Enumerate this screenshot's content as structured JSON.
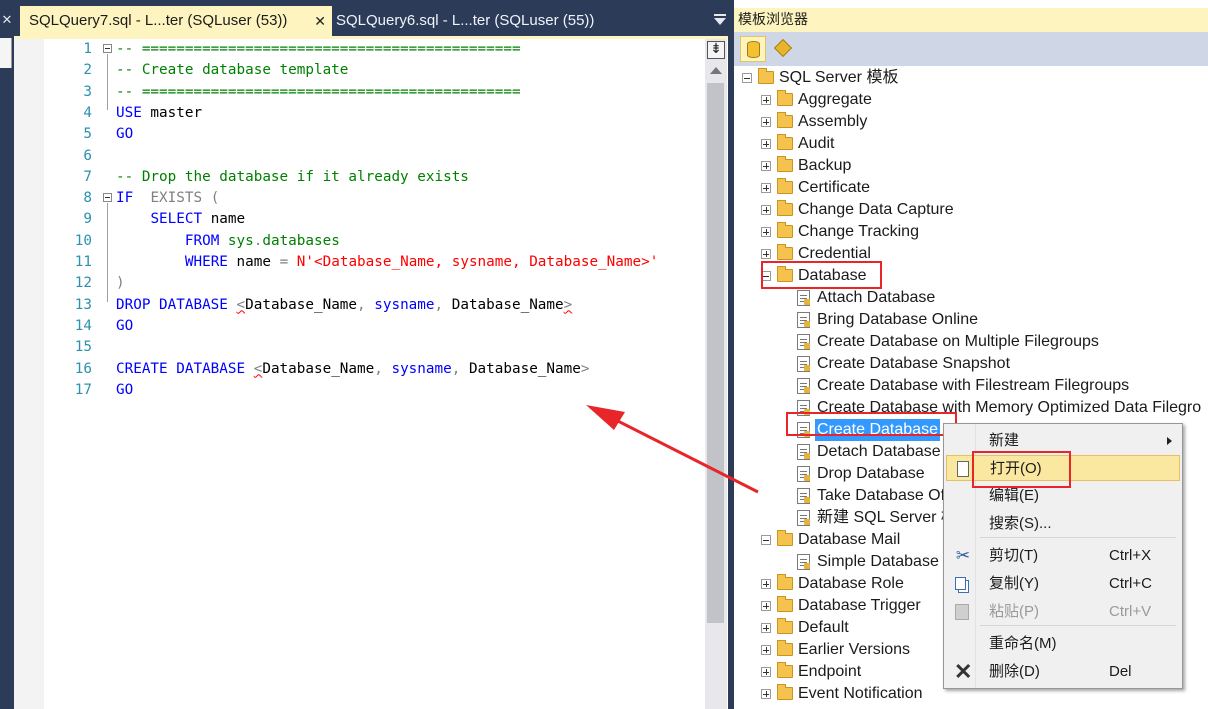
{
  "tabs": {
    "active_label": "SQLQuery7.sql - L...ter (SQLuser (53))",
    "active_close": "✕",
    "inactive_label": "SQLQuery6.sql - L...ter (SQLuser (55))"
  },
  "left_strip": {
    "close": "✕"
  },
  "editor": {
    "lines": [
      {
        "n": "1",
        "parts": [
          {
            "c": "cmt",
            "t": "-- ============================================"
          }
        ]
      },
      {
        "n": "2",
        "parts": [
          {
            "c": "cmt",
            "t": "-- Create database template"
          }
        ]
      },
      {
        "n": "3",
        "parts": [
          {
            "c": "cmt",
            "t": "-- ============================================"
          }
        ]
      },
      {
        "n": "4",
        "parts": [
          {
            "c": "kw",
            "t": "USE"
          },
          {
            "c": "txt",
            "t": " master"
          }
        ]
      },
      {
        "n": "5",
        "parts": [
          {
            "c": "kw",
            "t": "GO"
          }
        ]
      },
      {
        "n": "6",
        "parts": []
      },
      {
        "n": "7",
        "parts": [
          {
            "c": "cmt",
            "t": "-- Drop the database if it already exists"
          }
        ]
      },
      {
        "n": "8",
        "parts": [
          {
            "c": "kw",
            "t": "IF"
          },
          {
            "c": "txt",
            "t": "  "
          },
          {
            "c": "gray",
            "t": "EXISTS ("
          }
        ]
      },
      {
        "n": "9",
        "parts": [
          {
            "c": "txt",
            "t": "    "
          },
          {
            "c": "kw",
            "t": "SELECT"
          },
          {
            "c": "txt",
            "t": " name"
          }
        ]
      },
      {
        "n": "10",
        "parts": [
          {
            "c": "txt",
            "t": "        "
          },
          {
            "c": "kw",
            "t": "FROM"
          },
          {
            "c": "txt",
            "t": " "
          },
          {
            "c": "fn",
            "t": "sys"
          },
          {
            "c": "gray",
            "t": "."
          },
          {
            "c": "fn",
            "t": "databases"
          }
        ]
      },
      {
        "n": "11",
        "parts": [
          {
            "c": "txt",
            "t": "        "
          },
          {
            "c": "kw",
            "t": "WHERE"
          },
          {
            "c": "txt",
            "t": " name "
          },
          {
            "c": "gray",
            "t": "="
          },
          {
            "c": "txt",
            "t": " "
          },
          {
            "c": "str",
            "t": "N'<Database_Name, sysname, Database_Name>'"
          }
        ]
      },
      {
        "n": "12",
        "parts": [
          {
            "c": "gray",
            "t": ")"
          }
        ]
      },
      {
        "n": "13",
        "parts": [
          {
            "c": "kw",
            "t": "DROP DATABASE"
          },
          {
            "c": "txt",
            "t": " "
          },
          {
            "c": "gray squig",
            "t": "<"
          },
          {
            "c": "txt",
            "t": "Database_Name"
          },
          {
            "c": "gray",
            "t": ","
          },
          {
            "c": "txt",
            "t": " "
          },
          {
            "c": "kw",
            "t": "sysname"
          },
          {
            "c": "gray",
            "t": ","
          },
          {
            "c": "txt",
            "t": " Database_Name"
          },
          {
            "c": "gray squig",
            "t": ">"
          }
        ]
      },
      {
        "n": "14",
        "parts": [
          {
            "c": "kw",
            "t": "GO"
          }
        ]
      },
      {
        "n": "15",
        "parts": []
      },
      {
        "n": "16",
        "parts": [
          {
            "c": "kw",
            "t": "CREATE DATABASE"
          },
          {
            "c": "txt",
            "t": " "
          },
          {
            "c": "gray squig",
            "t": "<"
          },
          {
            "c": "txt",
            "t": "Database_Name"
          },
          {
            "c": "gray",
            "t": ","
          },
          {
            "c": "txt",
            "t": " "
          },
          {
            "c": "kw",
            "t": "sysname"
          },
          {
            "c": "gray",
            "t": ","
          },
          {
            "c": "txt",
            "t": " Database_Name"
          },
          {
            "c": "gray",
            "t": ">"
          }
        ]
      },
      {
        "n": "17",
        "parts": [
          {
            "c": "kw",
            "t": "GO"
          }
        ]
      }
    ]
  },
  "template_browser": {
    "title": "模板浏览器",
    "root": "SQL Server 模板",
    "folders_top": [
      "Aggregate",
      "Assembly",
      "Audit",
      "Backup",
      "Certificate",
      "Change Data Capture",
      "Change Tracking",
      "Credential"
    ],
    "database_folder": "Database",
    "database_items": [
      "Attach Database",
      "Bring Database Online",
      "Create Database on Multiple Filegroups",
      "Create Database Snapshot",
      "Create Database with Filestream Filegroups",
      "Create Database with Memory Optimized Data Filegro",
      "Create Database",
      "Detach Database",
      "Drop Database",
      "Take Database Of",
      "新建 SQL Server 模"
    ],
    "selected_item": "Create Database",
    "database_mail_folder": "Database Mail",
    "database_mail_items": [
      "Simple Database"
    ],
    "folders_bottom": [
      "Database Role",
      "Database Trigger",
      "Default",
      "Earlier Versions",
      "Endpoint",
      "Event Notification"
    ]
  },
  "context_menu": {
    "items": [
      {
        "label": "新建",
        "shortcut": "",
        "submenu": true,
        "icon": ""
      },
      {
        "label": "打开(O)",
        "shortcut": "",
        "icon": "doc-icon",
        "hover": true
      },
      {
        "label": "编辑(E)",
        "shortcut": "",
        "icon": ""
      },
      {
        "label": "搜索(S)...",
        "shortcut": "",
        "icon": ""
      },
      {
        "label": "剪切(T)",
        "shortcut": "Ctrl+X",
        "icon": "scissors-icon"
      },
      {
        "label": "复制(Y)",
        "shortcut": "Ctrl+C",
        "icon": "copy-icon"
      },
      {
        "label": "粘贴(P)",
        "shortcut": "Ctrl+V",
        "icon": "paste-icon",
        "disabled": true
      },
      {
        "label": "重命名(M)",
        "shortcut": "",
        "icon": ""
      },
      {
        "label": "删除(D)",
        "shortcut": "Del",
        "icon": "delete-icon"
      }
    ]
  },
  "colors": {
    "comment": "#008000",
    "keyword": "#0000ff",
    "string": "#ff0000",
    "annotation": "#e8262a",
    "selection": "#3399ff",
    "active_tab": "#fdf4bf"
  }
}
